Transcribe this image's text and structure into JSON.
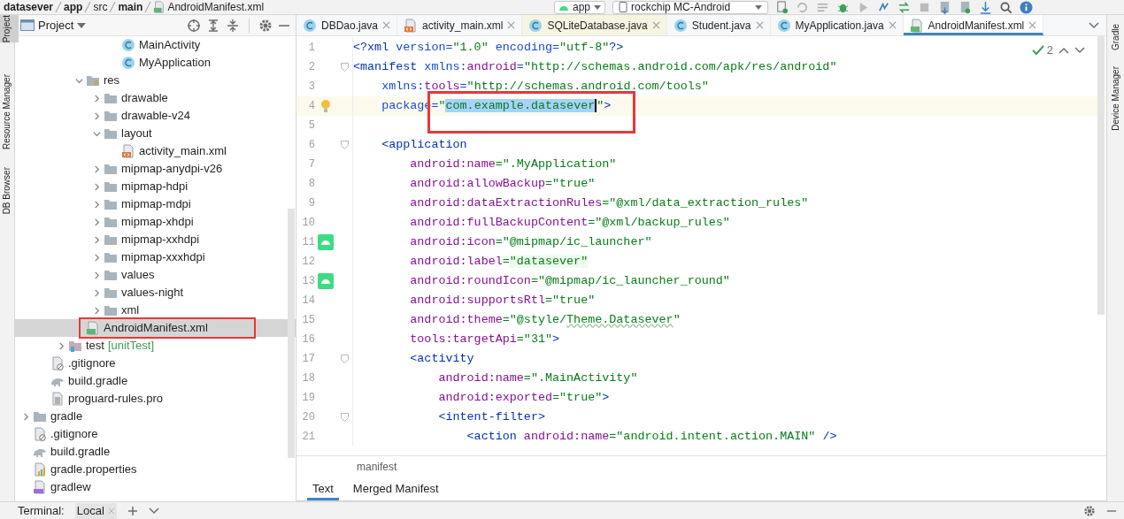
{
  "breadcrumb": [
    "datasever",
    "app",
    "src",
    "main",
    "AndroidManifest.xml"
  ],
  "toolbar": {
    "run_config": "app",
    "device": "rockchip MC-Android"
  },
  "left_tool_windows": [
    {
      "label": "Project",
      "selected": true
    },
    {
      "label": "Resource Manager",
      "selected": false
    },
    {
      "label": "DB Browser",
      "selected": false
    }
  ],
  "right_tool_windows": [
    {
      "label": "Gradle",
      "selected": false
    },
    {
      "label": "Device Manager",
      "selected": false
    }
  ],
  "project_panel": {
    "title": "Project",
    "tree": [
      {
        "children": [
          {
            "children": [
              {
                "children": [
                  {
                    "children": [
                      {
                        "children": [
                          {
                            "label": "MainActivity",
                            "kind": "class",
                            "selected": false
                          },
                          {
                            "label": "MyApplication",
                            "kind": "class",
                            "selected": false
                          }
                        ]
                      }
                    ]
                  },
                  {
                    "label": "res",
                    "kind": "resfolder",
                    "expanded": true,
                    "selected": false,
                    "children": [
                      {
                        "label": "drawable",
                        "kind": "folder",
                        "expanded": false,
                        "selected": false
                      },
                      {
                        "label": "drawable-v24",
                        "kind": "folder",
                        "expanded": false,
                        "selected": false
                      },
                      {
                        "label": "layout",
                        "kind": "folder",
                        "expanded": true,
                        "selected": false,
                        "children": [
                          {
                            "label": "activity_main.xml",
                            "kind": "layout",
                            "selected": false
                          }
                        ]
                      },
                      {
                        "label": "mipmap-anydpi-v26",
                        "kind": "folder",
                        "expanded": false,
                        "selected": false
                      },
                      {
                        "label": "mipmap-hdpi",
                        "kind": "folder",
                        "expanded": false,
                        "selected": false
                      },
                      {
                        "label": "mipmap-mdpi",
                        "kind": "folder",
                        "expanded": false,
                        "selected": false
                      },
                      {
                        "label": "mipmap-xhdpi",
                        "kind": "folder",
                        "expanded": false,
                        "selected": false
                      },
                      {
                        "label": "mipmap-xxhdpi",
                        "kind": "folder",
                        "expanded": false,
                        "selected": false
                      },
                      {
                        "label": "mipmap-xxxhdpi",
                        "kind": "folder",
                        "expanded": false,
                        "selected": false
                      },
                      {
                        "label": "values",
                        "kind": "folder",
                        "expanded": false,
                        "selected": false
                      },
                      {
                        "label": "values-night",
                        "kind": "folder",
                        "expanded": false,
                        "selected": false
                      },
                      {
                        "label": "xml",
                        "kind": "folder",
                        "expanded": false,
                        "selected": false
                      }
                    ]
                  },
                  {
                    "label": "AndroidManifest.xml",
                    "kind": "manifest",
                    "selected": true
                  }
                ]
              },
              {
                "label": "test",
                "tag": "[unitTest]",
                "kind": "testfolder",
                "expanded": false,
                "selected": false
              }
            ]
          },
          {
            "label": ".gitignore",
            "kind": "ignore",
            "selected": false
          },
          {
            "label": "build.gradle",
            "kind": "gradle",
            "selected": false
          },
          {
            "label": "proguard-rules.pro",
            "kind": "text",
            "selected": false
          }
        ]
      },
      {
        "label": "gradle",
        "kind": "folder",
        "expanded": false,
        "selected": false
      },
      {
        "label": ".gitignore",
        "kind": "ignore",
        "selected": false
      },
      {
        "label": "build.gradle",
        "kind": "gradle",
        "selected": false
      },
      {
        "label": "gradle.properties",
        "kind": "properties",
        "selected": false
      },
      {
        "label": "gradlew",
        "kind": "shell",
        "selected": false
      }
    ]
  },
  "tabs": [
    {
      "label": "DBDao.java",
      "kind": "class",
      "selected": false
    },
    {
      "label": "activity_main.xml",
      "kind": "layout",
      "selected": false
    },
    {
      "label": "SQLiteDatabase.java",
      "kind": "library",
      "selected": false
    },
    {
      "label": "Student.java",
      "kind": "class",
      "selected": false
    },
    {
      "label": "MyApplication.java",
      "kind": "class",
      "selected": false
    },
    {
      "label": "AndroidManifest.xml",
      "kind": "manifest",
      "selected": true
    }
  ],
  "inspections": "2",
  "code_lines": [
    {
      "number": "1",
      "current": false,
      "fold": false,
      "tokens": [
        {
          "kind": "tag",
          "text": "<?xml "
        },
        {
          "kind": "attr",
          "text": "version="
        },
        {
          "kind": "str",
          "text": "\"1.0\" "
        },
        {
          "kind": "attr",
          "text": "encoding="
        },
        {
          "kind": "str",
          "text": "\"utf-8\""
        },
        {
          "kind": "tag",
          "text": "?>"
        }
      ]
    },
    {
      "number": "2",
      "current": false,
      "fold": true,
      "tokens": [
        {
          "kind": "tag",
          "text": "<manifest "
        },
        {
          "kind": "attr",
          "text": "xmlns:"
        },
        {
          "kind": "ns",
          "text": "android"
        },
        {
          "kind": "attr",
          "text": "="
        },
        {
          "kind": "str",
          "text": "\"http://schemas.android.com/apk/res/android\""
        }
      ]
    },
    {
      "number": "3",
      "current": false,
      "fold": false,
      "tokens": [
        {
          "kind": "attr",
          "text": "    xmlns:"
        },
        {
          "kind": "ns",
          "text": "tools"
        },
        {
          "kind": "attr",
          "text": "="
        },
        {
          "kind": "str",
          "text": "\"http://schemas.android.com/tools\""
        }
      ]
    },
    {
      "number": "4",
      "current": true,
      "fold": false,
      "gutter": {
        "kind": "bulb"
      },
      "tokens": [
        {
          "kind": "attr",
          "text": "    package="
        },
        {
          "kind": "str",
          "text": "\""
        },
        {
          "kind": "selection",
          "text": "com.example.datasever"
        },
        {
          "kind": "str",
          "text": "\""
        },
        {
          "kind": "tag",
          "text": ">"
        }
      ]
    },
    {
      "number": "5",
      "current": false,
      "fold": false
    },
    {
      "number": "6",
      "current": false,
      "fold": true,
      "tokens": [
        {
          "kind": "tag",
          "text": "    <application"
        }
      ]
    },
    {
      "number": "7",
      "current": false,
      "fold": false,
      "tokens": [
        {
          "kind": "ns",
          "text": "        android:name"
        },
        {
          "kind": "str",
          "text": "=\".MyApplication\""
        }
      ]
    },
    {
      "number": "8",
      "current": false,
      "fold": false,
      "tokens": [
        {
          "kind": "ns",
          "text": "        android:allowBackup"
        },
        {
          "kind": "str",
          "text": "=\"true\""
        }
      ]
    },
    {
      "number": "9",
      "current": false,
      "fold": false,
      "tokens": [
        {
          "kind": "ns",
          "text": "        android:dataExtractionRules"
        },
        {
          "kind": "str",
          "text": "=\"@xml/data_extraction_rules\""
        }
      ]
    },
    {
      "number": "10",
      "current": false,
      "fold": false,
      "tokens": [
        {
          "kind": "ns",
          "text": "        android:fullBackupContent"
        },
        {
          "kind": "str",
          "text": "=\"@xml/backup_rules\""
        }
      ]
    },
    {
      "number": "11",
      "current": false,
      "fold": false,
      "gutter": {
        "kind": "android"
      },
      "tokens": [
        {
          "kind": "ns",
          "text": "        android:icon"
        },
        {
          "kind": "str",
          "text": "=\"@mipmap/ic_launcher\""
        }
      ]
    },
    {
      "number": "12",
      "current": false,
      "fold": false,
      "tokens": [
        {
          "kind": "ns",
          "text": "        android:label"
        },
        {
          "kind": "str",
          "text": "="
        },
        {
          "kind": "str_highlight",
          "text": "\"datasever\""
        }
      ]
    },
    {
      "number": "13",
      "current": false,
      "fold": false,
      "gutter": {
        "kind": "android"
      },
      "tokens": [
        {
          "kind": "ns",
          "text": "        android:roundIcon"
        },
        {
          "kind": "str",
          "text": "=\"@mipmap/ic_launcher_round\""
        }
      ]
    },
    {
      "number": "14",
      "current": false,
      "fold": false,
      "tokens": [
        {
          "kind": "ns",
          "text": "        android:supportsRtl"
        },
        {
          "kind": "str",
          "text": "=\"true\""
        }
      ]
    },
    {
      "number": "15",
      "current": false,
      "fold": false,
      "tokens": [
        {
          "kind": "ns",
          "text": "        android:theme"
        },
        {
          "kind": "str",
          "text": "=\"@style/"
        },
        {
          "kind": "str_typo",
          "text": "Theme.Datasever"
        },
        {
          "kind": "str",
          "text": "\""
        }
      ]
    },
    {
      "number": "16",
      "current": false,
      "fold": false,
      "tokens": [
        {
          "kind": "ns",
          "text": "        tools:targetApi"
        },
        {
          "kind": "str",
          "text": "=\"31\""
        },
        {
          "kind": "tag",
          "text": ">"
        }
      ]
    },
    {
      "number": "17",
      "current": false,
      "fold": true,
      "tokens": [
        {
          "kind": "tag",
          "text": "        <activity"
        }
      ]
    },
    {
      "number": "18",
      "current": false,
      "fold": false,
      "tokens": [
        {
          "kind": "ns",
          "text": "            android:name"
        },
        {
          "kind": "str",
          "text": "=\".MainActivity\""
        }
      ]
    },
    {
      "number": "19",
      "current": false,
      "fold": false,
      "tokens": [
        {
          "kind": "ns",
          "text": "            android:exported"
        },
        {
          "kind": "str",
          "text": "=\"true\""
        },
        {
          "kind": "tag",
          "text": ">"
        }
      ]
    },
    {
      "number": "20",
      "current": false,
      "fold": true,
      "tokens": [
        {
          "kind": "tag",
          "text": "            <intent-filter>"
        }
      ]
    },
    {
      "number": "21",
      "current": false,
      "fold": false,
      "tokens": [
        {
          "kind": "tag",
          "text": "                <action "
        },
        {
          "kind": "ns",
          "text": "android:name"
        },
        {
          "kind": "str",
          "text": "=\"android.intent.action.MAIN\""
        },
        {
          "kind": "tag",
          "text": " />"
        }
      ]
    }
  ],
  "editor_breadcrumb": "manifest",
  "editor_tabs": [
    {
      "label": "Text",
      "selected": true
    },
    {
      "label": "Merged Manifest",
      "selected": false
    }
  ],
  "bottom_bar": {
    "label": "Terminal:",
    "tabs": [
      {
        "label": "Local",
        "selected": true
      }
    ]
  }
}
